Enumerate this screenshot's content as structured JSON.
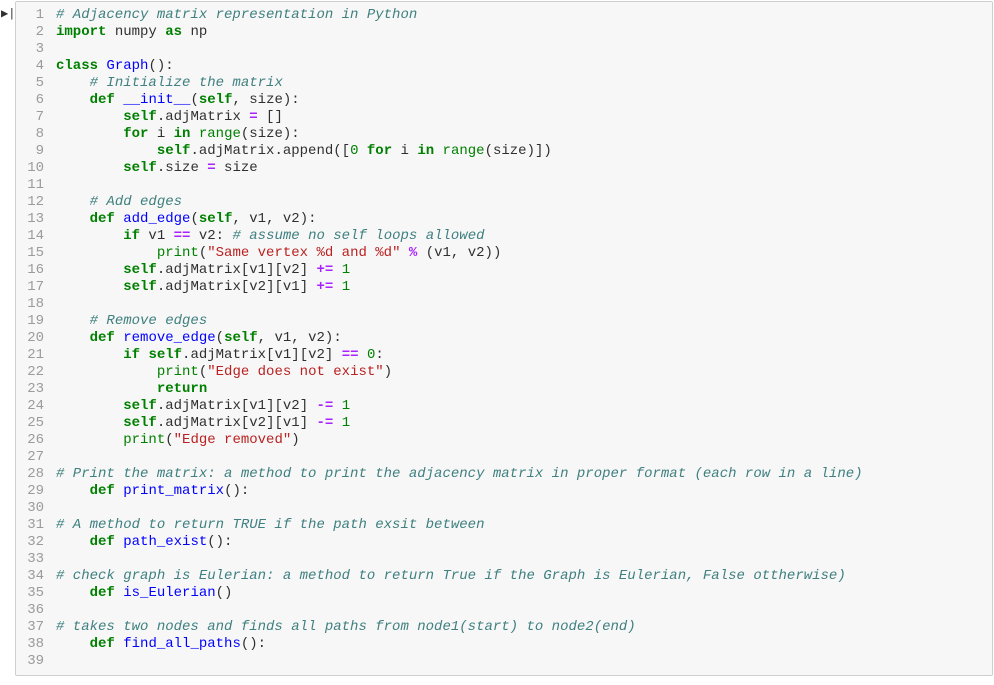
{
  "prompt_glyph": "▶|",
  "lines": [
    [
      [
        "comment",
        "# Adjacency matrix representation in Python"
      ]
    ],
    [
      [
        "keyword",
        "import"
      ],
      [
        "text",
        " numpy "
      ],
      [
        "keyword",
        "as"
      ],
      [
        "text",
        " np"
      ]
    ],
    [
      [
        "text",
        ""
      ]
    ],
    [
      [
        "keyword",
        "class"
      ],
      [
        "text",
        " "
      ],
      [
        "def",
        "Graph"
      ],
      [
        "punct",
        "():"
      ]
    ],
    [
      [
        "text",
        "    "
      ],
      [
        "comment",
        "# Initialize the matrix"
      ]
    ],
    [
      [
        "text",
        "    "
      ],
      [
        "keyword",
        "def"
      ],
      [
        "text",
        " "
      ],
      [
        "def",
        "__init__"
      ],
      [
        "punct",
        "("
      ],
      [
        "self",
        "self"
      ],
      [
        "punct",
        "),"
      ],
      [
        "_undo",
        ""
      ]
    ],
    [
      [
        "text",
        "        "
      ],
      [
        "self",
        "self"
      ],
      [
        "punct",
        "."
      ],
      [
        "text",
        "adjMatrix "
      ],
      [
        "operator",
        "="
      ],
      [
        "text",
        " []"
      ]
    ],
    [
      [
        "text",
        "        "
      ],
      [
        "keyword",
        "for"
      ],
      [
        "text",
        " i "
      ],
      [
        "keyword",
        "in"
      ],
      [
        "text",
        " "
      ],
      [
        "builtin",
        "range"
      ],
      [
        "punct",
        "("
      ],
      [
        "text",
        "size"
      ],
      [
        "punct",
        "):"
      ]
    ],
    [
      [
        "text",
        "            "
      ],
      [
        "self",
        "self"
      ],
      [
        "punct",
        "."
      ],
      [
        "text",
        "adjMatrix.append"
      ],
      [
        "punct",
        "(["
      ],
      [
        "number",
        "0"
      ],
      [
        "text",
        " "
      ],
      [
        "keyword",
        "for"
      ],
      [
        "text",
        " i "
      ],
      [
        "keyword",
        "in"
      ],
      [
        "text",
        " "
      ],
      [
        "builtin",
        "range"
      ],
      [
        "punct",
        "("
      ],
      [
        "text",
        "size"
      ],
      [
        "punct",
        ")])"
      ]
    ],
    [
      [
        "text",
        "        "
      ],
      [
        "self",
        "self"
      ],
      [
        "punct",
        "."
      ],
      [
        "text",
        "size "
      ],
      [
        "operator",
        "="
      ],
      [
        "text",
        " size"
      ]
    ],
    [
      [
        "text",
        ""
      ]
    ],
    [
      [
        "text",
        "    "
      ],
      [
        "comment",
        "# Add edges"
      ]
    ],
    [
      [
        "text",
        "    "
      ],
      [
        "keyword",
        "def"
      ],
      [
        "text",
        " "
      ],
      [
        "def",
        "add_edge"
      ],
      [
        "punct",
        "("
      ],
      [
        "self",
        "self"
      ],
      [
        "punct",
        ", "
      ],
      [
        "text",
        "v1"
      ],
      [
        "punct",
        ", "
      ],
      [
        "text",
        "v2"
      ],
      [
        "punct",
        "):"
      ]
    ],
    [
      [
        "text",
        "        "
      ],
      [
        "keyword",
        "if"
      ],
      [
        "text",
        " v1 "
      ],
      [
        "operator",
        "=="
      ],
      [
        "text",
        " v2: "
      ],
      [
        "comment",
        "# assume no self loops allowed"
      ]
    ],
    [
      [
        "text",
        "            "
      ],
      [
        "builtin",
        "print"
      ],
      [
        "punct",
        "("
      ],
      [
        "string",
        "\"Same vertex %d and %d\""
      ],
      [
        "text",
        " "
      ],
      [
        "operator",
        "%"
      ],
      [
        "text",
        " "
      ],
      [
        "punct",
        "("
      ],
      [
        "text",
        "v1"
      ],
      [
        "punct",
        ", "
      ],
      [
        "text",
        "v2"
      ],
      [
        "punct",
        "))"
      ]
    ],
    [
      [
        "text",
        "        "
      ],
      [
        "self",
        "self"
      ],
      [
        "punct",
        "."
      ],
      [
        "text",
        "adjMatrix"
      ],
      [
        "punct",
        "["
      ],
      [
        "text",
        "v1"
      ],
      [
        "punct",
        "]["
      ],
      [
        "text",
        "v2"
      ],
      [
        "punct",
        "] "
      ],
      [
        "operator",
        "+="
      ],
      [
        "text",
        " "
      ],
      [
        "number",
        "1"
      ]
    ],
    [
      [
        "text",
        "        "
      ],
      [
        "self",
        "self"
      ],
      [
        "punct",
        "."
      ],
      [
        "text",
        "adjMatrix"
      ],
      [
        "punct",
        "["
      ],
      [
        "text",
        "v2"
      ],
      [
        "punct",
        "]["
      ],
      [
        "text",
        "v1"
      ],
      [
        "punct",
        "] "
      ],
      [
        "operator",
        "+="
      ],
      [
        "text",
        " "
      ],
      [
        "number",
        "1"
      ]
    ],
    [
      [
        "text",
        ""
      ]
    ],
    [
      [
        "text",
        "    "
      ],
      [
        "comment",
        "# Remove edges"
      ]
    ],
    [
      [
        "text",
        "    "
      ],
      [
        "keyword",
        "def"
      ],
      [
        "text",
        " "
      ],
      [
        "def",
        "remove_edge"
      ],
      [
        "punct",
        "("
      ],
      [
        "self",
        "self"
      ],
      [
        "punct",
        ", "
      ],
      [
        "text",
        "v1"
      ],
      [
        "punct",
        ", "
      ],
      [
        "text",
        "v2"
      ],
      [
        "punct",
        "):"
      ]
    ],
    [
      [
        "text",
        "        "
      ],
      [
        "keyword",
        "if"
      ],
      [
        "text",
        " "
      ],
      [
        "self",
        "self"
      ],
      [
        "punct",
        "."
      ],
      [
        "text",
        "adjMatrix"
      ],
      [
        "punct",
        "["
      ],
      [
        "text",
        "v1"
      ],
      [
        "punct",
        "]["
      ],
      [
        "text",
        "v2"
      ],
      [
        "punct",
        "] "
      ],
      [
        "operator",
        "=="
      ],
      [
        "text",
        " "
      ],
      [
        "number",
        "0"
      ],
      [
        "punct",
        ":"
      ]
    ],
    [
      [
        "text",
        "            "
      ],
      [
        "builtin",
        "print"
      ],
      [
        "punct",
        "("
      ],
      [
        "string",
        "\"Edge does not exist\""
      ],
      [
        "punct",
        ")"
      ]
    ],
    [
      [
        "text",
        "            "
      ],
      [
        "keyword",
        "return"
      ]
    ],
    [
      [
        "text",
        "        "
      ],
      [
        "self",
        "self"
      ],
      [
        "punct",
        "."
      ],
      [
        "text",
        "adjMatrix"
      ],
      [
        "punct",
        "["
      ],
      [
        "text",
        "v1"
      ],
      [
        "punct",
        "]["
      ],
      [
        "text",
        "v2"
      ],
      [
        "punct",
        "] "
      ],
      [
        "operator",
        "-="
      ],
      [
        "text",
        " "
      ],
      [
        "number",
        "1"
      ]
    ],
    [
      [
        "text",
        "        "
      ],
      [
        "self",
        "self"
      ],
      [
        "punct",
        "."
      ],
      [
        "text",
        "adjMatrix"
      ],
      [
        "punct",
        "["
      ],
      [
        "text",
        "v2"
      ],
      [
        "punct",
        "]["
      ],
      [
        "text",
        "v1"
      ],
      [
        "punct",
        "] "
      ],
      [
        "operator",
        "-="
      ],
      [
        "text",
        " "
      ],
      [
        "number",
        "1"
      ]
    ],
    [
      [
        "text",
        "        "
      ],
      [
        "builtin",
        "print"
      ],
      [
        "punct",
        "("
      ],
      [
        "string",
        "\"Edge removed\""
      ],
      [
        "punct",
        ")"
      ]
    ],
    [
      [
        "text",
        ""
      ]
    ],
    [
      [
        "comment",
        "# Print the matrix: a method to print the adjacency matrix in proper format (each row in a line)"
      ]
    ],
    [
      [
        "text",
        "    "
      ],
      [
        "keyword",
        "def"
      ],
      [
        "text",
        " "
      ],
      [
        "def",
        "print_matrix"
      ],
      [
        "punct",
        "():"
      ]
    ],
    [
      [
        "text",
        ""
      ]
    ],
    [
      [
        "comment",
        "# A method to return TRUE if the path exsit between "
      ]
    ],
    [
      [
        "text",
        "    "
      ],
      [
        "keyword",
        "def"
      ],
      [
        "text",
        " "
      ],
      [
        "def",
        "path_exist"
      ],
      [
        "punct",
        "():"
      ]
    ],
    [
      [
        "text",
        ""
      ]
    ],
    [
      [
        "comment",
        "# check graph is Eulerian: a method to return True if the Graph is Eulerian, False ottherwise)"
      ]
    ],
    [
      [
        "text",
        "    "
      ],
      [
        "keyword",
        "def"
      ],
      [
        "text",
        " "
      ],
      [
        "def",
        "is_Eulerian"
      ],
      [
        "punct",
        "()"
      ]
    ],
    [
      [
        "text",
        ""
      ]
    ],
    [
      [
        "comment",
        "# takes two nodes and finds all paths from node1(start) to node2(end)"
      ]
    ],
    [
      [
        "text",
        "    "
      ],
      [
        "keyword",
        "def"
      ],
      [
        "text",
        " "
      ],
      [
        "def",
        "find_all_paths"
      ],
      [
        "punct",
        "():"
      ]
    ],
    [
      [
        "text",
        ""
      ]
    ]
  ],
  "line6_fix": [
    [
      "text",
      "    "
    ],
    [
      "keyword",
      "def"
    ],
    [
      "text",
      " "
    ],
    [
      "def",
      "__init__"
    ],
    [
      "punct",
      "("
    ],
    [
      "self",
      "self"
    ],
    [
      "punct",
      ", "
    ],
    [
      "text",
      "size"
    ],
    [
      "punct",
      "):"
    ]
  ]
}
